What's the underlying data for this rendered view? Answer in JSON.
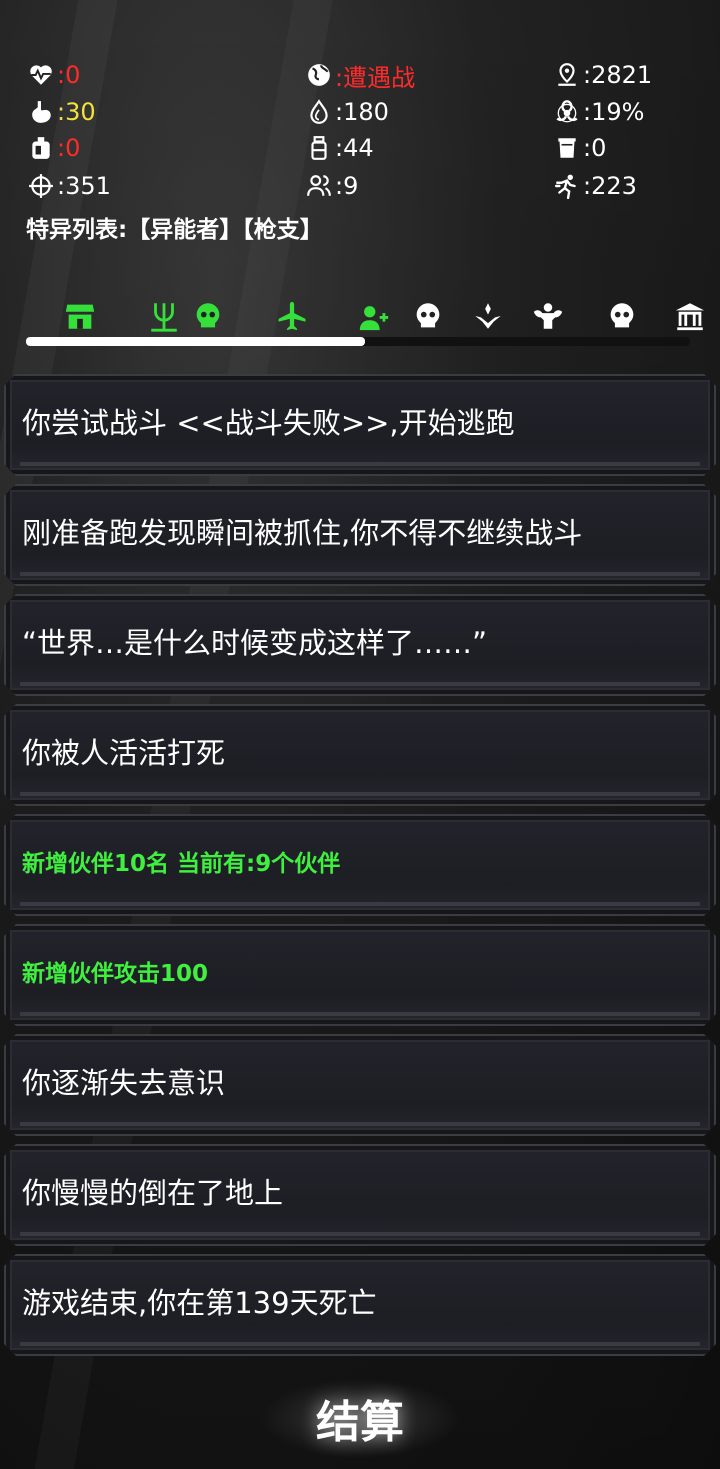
{
  "stats": {
    "health": ":0",
    "stomach": ":30",
    "water_can": ":0",
    "crosshair": ":351",
    "status": ":遭遇战",
    "water": ":180",
    "bottle": ":44",
    "companions": ":9",
    "distance": ":2821",
    "infection": ":19%",
    "cup": ":0",
    "speed": ":223"
  },
  "traits": "特异列表:【异能者】【枪支】",
  "tabs": [
    {
      "icon": "shop-icon",
      "color": "#35e03a"
    },
    {
      "icon": "trident-icon",
      "color": "#35e03a"
    },
    {
      "icon": "skull-icon",
      "color": "#35e03a"
    },
    {
      "icon": "plane-icon",
      "color": "#35e03a"
    },
    {
      "icon": "add-user-icon",
      "color": "#35e03a"
    },
    {
      "icon": "skull-icon",
      "color": "#ffffff"
    },
    {
      "icon": "hands-icon",
      "color": "#ffffff"
    },
    {
      "icon": "muscle-icon",
      "color": "#ffffff"
    },
    {
      "icon": "skull-icon",
      "color": "#ffffff"
    },
    {
      "icon": "bank-icon",
      "color": "#ffffff"
    }
  ],
  "progress": 0.51,
  "log": [
    {
      "text": "你尝试战斗 <<战斗失败>>,开始逃跑",
      "color": "white"
    },
    {
      "text": "刚准备跑发现瞬间被抓住,你不得不继续战斗",
      "color": "white"
    },
    {
      "text": "“世界…是什么时候变成这样了……”",
      "color": "white"
    },
    {
      "text": "你被人活活打死",
      "color": "white"
    },
    {
      "text": "新增伙伴10名  当前有:9个伙伴",
      "color": "green"
    },
    {
      "text": "新增伙伴攻击100",
      "color": "green"
    },
    {
      "text": "你逐渐失去意识",
      "color": "white"
    },
    {
      "text": "你慢慢的倒在了地上",
      "color": "white"
    },
    {
      "text": "游戏结束,你在第139天死亡",
      "color": "white"
    }
  ],
  "settle_label": "结算"
}
